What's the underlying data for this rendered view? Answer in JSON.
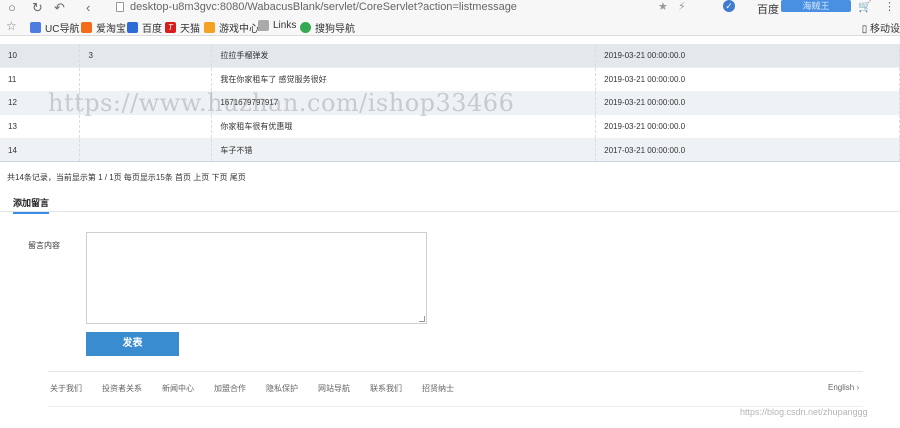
{
  "browser": {
    "url": "desktop-u8m3gvc:8080/WabacusBlank/servlet/CoreServlet?action=listmessage",
    "search_engine": "百度",
    "search_placeholder": "海贼王",
    "nav": {
      "back": "‹",
      "reload": "↻",
      "undo": "↶"
    }
  },
  "bookmarks": {
    "items": [
      {
        "label": "UC导航",
        "color": "#4f7ce0"
      },
      {
        "label": "爱淘宝",
        "color": "#f46b1c"
      },
      {
        "label": "百度",
        "color": "#2d6cd8"
      },
      {
        "label": "天猫",
        "color": "#d91d1d"
      },
      {
        "label": "游戏中心",
        "color": "#f3a321"
      },
      {
        "label": "Links",
        "color": "#aaaaaa"
      },
      {
        "label": "搜狗导航",
        "color": "#34a853"
      }
    ],
    "mobile": "移动设"
  },
  "table": {
    "rows": [
      {
        "id": "10",
        "user": "3",
        "content": "拉拉手榴弹发",
        "time": "2019-03-21 00:00:00.0"
      },
      {
        "id": "11",
        "user": "",
        "content": "我在你家租车了 感觉服务很好",
        "time": "2019-03-21 00:00:00.0"
      },
      {
        "id": "12",
        "user": "",
        "content": "1671679797917",
        "time": "2019-03-21 00:00:00.0"
      },
      {
        "id": "13",
        "user": "",
        "content": "你家租车很有优惠哦",
        "time": "2019-03-21 00:00:00.0"
      },
      {
        "id": "14",
        "user": "",
        "content": "车子不错",
        "time": "2017-03-21 00:00:00.0"
      }
    ]
  },
  "pager": {
    "text": "共14条记录，当前显示第 1 / 1页 每页显示15条 首页 上页 下页 尾页"
  },
  "form": {
    "tab_label": "添加留言",
    "content_label": "留言内容",
    "content_value": "",
    "submit_label": "发表"
  },
  "footer": {
    "links": [
      "关于我们",
      "投资者关系",
      "新闻中心",
      "加盟合作",
      "隐私保护",
      "网站导航",
      "联系我们",
      "招贤纳士"
    ],
    "lang": "English ›"
  },
  "watermarks": {
    "main": "https://www.huzhan.com/ishop33466",
    "blog": "https://blog.csdn.net/zhupanggg"
  }
}
